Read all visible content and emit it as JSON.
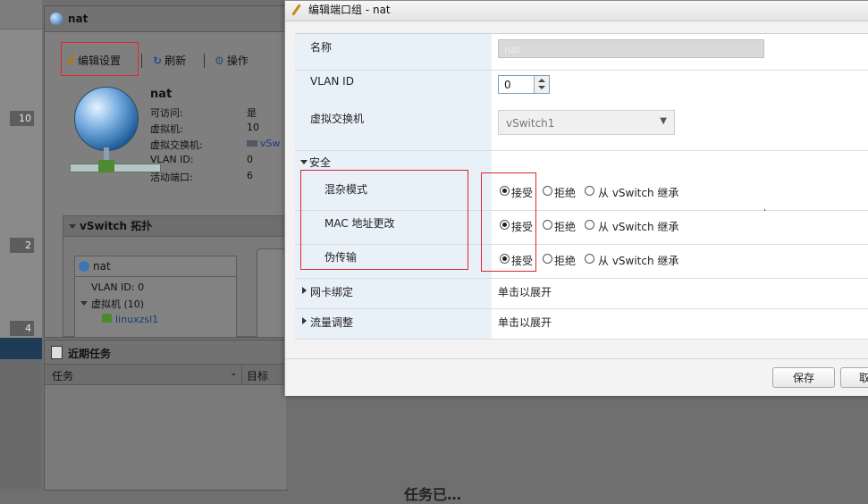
{
  "background": {
    "left_counts": [
      "10",
      "2",
      "4"
    ],
    "network_title": "nat",
    "toolbar": {
      "edit": "编辑设置",
      "refresh": "刷新",
      "actions": "操作"
    },
    "summary": {
      "name": "nat",
      "rows": [
        {
          "k": "可访问:",
          "v": "是"
        },
        {
          "k": "虚拟机:",
          "v": "10"
        },
        {
          "k": "虚拟交换机:",
          "v": "vSw"
        },
        {
          "k": "VLAN ID:",
          "v": "0"
        },
        {
          "k": "活动端口:",
          "v": "6"
        }
      ]
    },
    "topology": {
      "title": "vSwitch 拓扑",
      "port_group": "nat",
      "vlan": "VLAN ID: 0",
      "vms": "虚拟机 (10)",
      "vm1": "linuxzsl1"
    },
    "tasks": {
      "title": "近期任务",
      "col_task": "任务",
      "col_target": "目标"
    },
    "bottom_text": "任务已…"
  },
  "dialog": {
    "title": "编辑端口组 - nat",
    "name_label": "名称",
    "name_value": "nat",
    "vlan_label": "VLAN ID",
    "vlan_value": "0",
    "vswitch_label": "虚拟交换机",
    "vswitch_value": "vSwitch1",
    "security_label": "安全",
    "security_rows": [
      {
        "label": "混杂模式",
        "selected": "接受"
      },
      {
        "label": "MAC 地址更改",
        "selected": "接受"
      },
      {
        "label": "伪传输",
        "selected": "接受"
      }
    ],
    "options": {
      "accept": "接受",
      "reject": "拒绝",
      "inherit": "从 vSwitch 继承"
    },
    "nic_teaming_label": "网卡绑定",
    "nic_teaming_value": "单击以展开",
    "traffic_shaping_label": "流量调整",
    "traffic_shaping_value": "单击以展开",
    "save_label": "保存",
    "cancel_label": "取消"
  },
  "colors": {
    "highlight": "#e0262e",
    "label_column": "#e8f0f8",
    "dim_overlay": "#6f6f6f"
  }
}
